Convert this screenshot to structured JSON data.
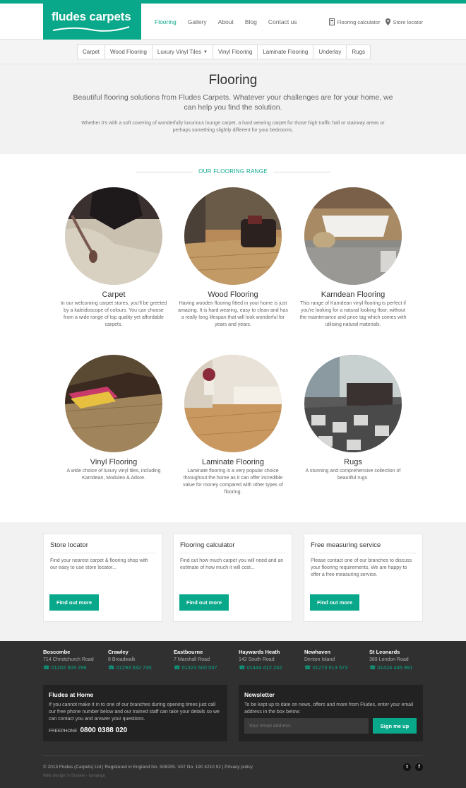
{
  "brand": {
    "name": "fludes carpets",
    "accent": "#0aa88a"
  },
  "nav": {
    "items": [
      {
        "label": "Flooring"
      },
      {
        "label": "Gallery"
      },
      {
        "label": "About"
      },
      {
        "label": "Blog"
      },
      {
        "label": "Contact us"
      }
    ],
    "active": "Flooring"
  },
  "utility": {
    "calculator": "Flooring calculator",
    "store_locator": "Store locator"
  },
  "subnav": {
    "items": [
      {
        "label": "Carpet"
      },
      {
        "label": "Wood Flooring"
      },
      {
        "label": "Luxury Vinyl Tiles"
      },
      {
        "label": "Vinyl Flooring"
      },
      {
        "label": "Laminate Flooring"
      },
      {
        "label": "Underlay"
      },
      {
        "label": "Rugs"
      }
    ]
  },
  "hero": {
    "title": "Flooring",
    "lede": "Beautiful flooring solutions from Fludes Carpets. Whatever your challenges are for your home, we can help you find the solution.",
    "text": "Whether it's with a soft covering of wonderfully luxurious lounge carpet, a hard wearing carpet for those high traffic hall or stairway areas or perhaps something slightly different for your bedrooms."
  },
  "range": {
    "title": "OUR FLOORING RANGE",
    "items": [
      {
        "name": "Carpet",
        "text": "In our welcoming carpet stores, you'll be greeted by a kaleidoscope of colours. You can choose from a wide range of top quality yet affordable carpets."
      },
      {
        "name": "Wood Flooring",
        "text": "Having wooden flooring fitted in your home is just amazing. It is hard wearing, easy to clean and has a really long lifespan that will look wonderful for years and years."
      },
      {
        "name": "Karndean Flooring",
        "text": "This range of Karndean vinyl flooring is perfect if you're looking for a natural looking floor, without the maintenance and price tag which comes with utilising natural materials."
      },
      {
        "name": "Vinyl Flooring",
        "text": "A wide choice of luxury vinyl tiles, including Karndean, Moduleo & Adore."
      },
      {
        "name": "Laminate Flooring",
        "text": "Laminate flooring is a very popular choice throughout the home as it can offer incredible value for money compared with other types of flooring."
      },
      {
        "name": "Rugs",
        "text": "A stunning and comprehensive collection of beautiful rugs."
      }
    ]
  },
  "cards": [
    {
      "title": "Store locator",
      "text": "Find your nearest carpet & flooring shop with our easy to use store locator...",
      "button": "Find out more"
    },
    {
      "title": "Flooring calculator",
      "text": "Find out how much carpet you will need and an estimate of how much it will cost...",
      "button": "Find out more"
    },
    {
      "title": "Free measuring service",
      "text": "Please contact one of our branches to discuss your flooring requirements. We are happy to offer a free measuring service.",
      "button": "Find out more"
    }
  ],
  "branches": [
    {
      "name": "Boscombe",
      "address": "714 Christchurch Road",
      "phone": "01202 309 296"
    },
    {
      "name": "Crawley",
      "address": "8 Broadwalk",
      "phone": "01293 532 730"
    },
    {
      "name": "Eastbourne",
      "address": "7 Marshall Road",
      "phone": "01323 500 537"
    },
    {
      "name": "Haywards Heath",
      "address": "142 South Road",
      "phone": "01444 412 242"
    },
    {
      "name": "Newhaven",
      "address": "Denton Island",
      "phone": "01273 513 573"
    },
    {
      "name": "St Leonards",
      "address": "389 London Road",
      "phone": "01424 445 991"
    }
  ],
  "at_home": {
    "title": "Fludes at Home",
    "text": "If you cannot make it in to one of our branches during opening times just call our free phone number below and our trained staff can take your details so we can contact you and answer your questions.",
    "freephone_label": "FREEPHONE",
    "freephone_number": "0800 0388 020"
  },
  "newsletter": {
    "title": "Newsletter",
    "text": "To be kept up to date on news, offers and more from Fludes, enter your email address in the box below:",
    "placeholder": "Your email address",
    "button": "Sign me up"
  },
  "legal": {
    "copyright": "© 2013 Fludes (Carpets) Ltd  |  Registered in England No. 508205.  VAT No. 190 4210 92  |  Privacy policy",
    "credit": "Web design in Sussex - tomango"
  },
  "social": {
    "twitter": "t",
    "facebook": "f"
  }
}
